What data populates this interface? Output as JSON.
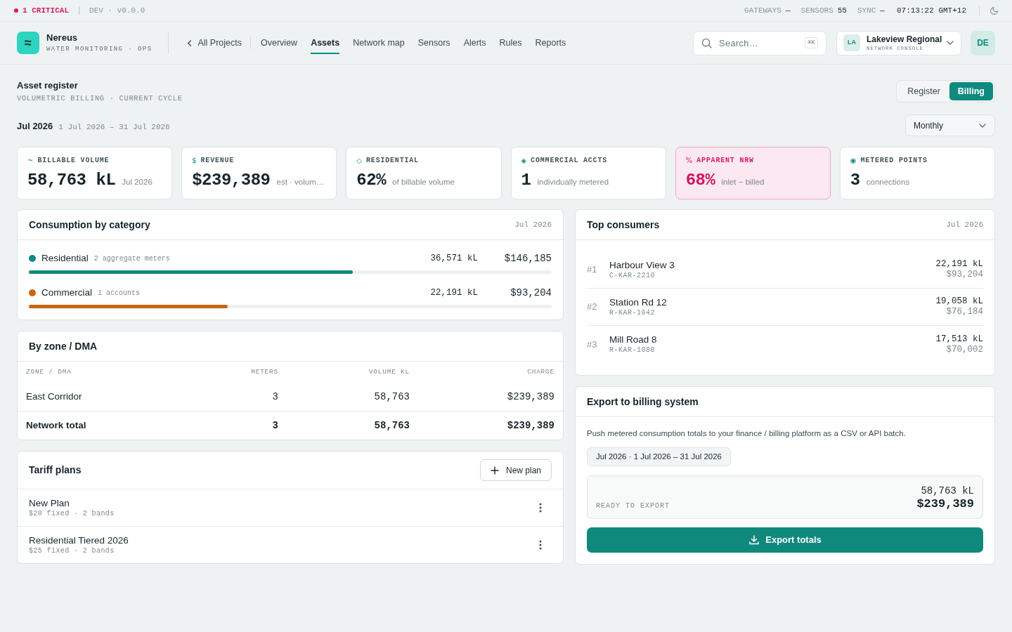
{
  "status_bar": {
    "critical": "1 CRITICAL",
    "environment": "DEV · v0.0.0",
    "stats": [
      {
        "label": "GATEWAYS",
        "value": "—"
      },
      {
        "label": "SENSORS",
        "value": "55"
      },
      {
        "label": "SYNC",
        "value": "—"
      }
    ],
    "clock": "07:13:22 GMT+12"
  },
  "header": {
    "logo": "≈",
    "app_name": "Nereus",
    "tagline": "WATER MONITORING · OPS",
    "back_link": "All Projects",
    "nav": [
      {
        "label": "Overview",
        "selected": false
      },
      {
        "label": "Assets",
        "selected": true
      },
      {
        "label": "Network map",
        "selected": false
      },
      {
        "label": "Sensors",
        "selected": false
      },
      {
        "label": "Alerts",
        "selected": false
      },
      {
        "label": "Rules",
        "selected": false
      },
      {
        "label": "Reports",
        "selected": false
      }
    ],
    "search": {
      "placeholder": "Search…",
      "shortcut": "⌘K"
    },
    "workspace": {
      "initials": "LA",
      "name": "Lakeview Regional",
      "subtitle": "NETWORK CONSOLE"
    },
    "user_initials": "DE"
  },
  "page": {
    "title": "Asset register",
    "subtitle": "VOLUMETRIC BILLING · CURRENT CYCLE",
    "period": "Jul 2026",
    "range": "1 Jul 2026 – 31 Jul 2026"
  },
  "view_toggle": [
    {
      "label": "Register",
      "selected": false
    },
    {
      "label": "Billing",
      "selected": true
    }
  ],
  "interval": "Monthly",
  "kpis": [
    {
      "marker": "~",
      "label": "BILLABLE VOLUME",
      "value": "58,763 kL",
      "note": "Jul 2026",
      "alert": false
    },
    {
      "marker": "$",
      "label": "REVENUE",
      "value": "$239,389",
      "note": "est · volum…",
      "alert": false
    },
    {
      "marker": "◇",
      "label": "RESIDENTIAL",
      "value": "62%",
      "note": "of billable volume",
      "alert": false
    },
    {
      "marker": "◈",
      "label": "COMMERCIAL ACCTS",
      "value": "1",
      "note": "individually metered",
      "alert": false
    },
    {
      "marker": "%",
      "label": "APPARENT NRW",
      "value": "68%",
      "note": "inlet − billed",
      "alert": true
    },
    {
      "marker": "◉",
      "label": "METERED POINTS",
      "value": "3",
      "note": "connections",
      "alert": false
    }
  ],
  "consumption": {
    "title": "Consumption by category",
    "period": "Jul 2026",
    "categories": [
      {
        "name": "Residential",
        "detail": "2 aggregate meters",
        "volume": "36,571 kL",
        "charge": "$146,185",
        "level": 0.62,
        "color": "#0f8a7e"
      },
      {
        "name": "Commercial",
        "detail": "1 accounts",
        "volume": "22,191 kL",
        "charge": "$93,204",
        "level": 0.38,
        "color": "#c8650f"
      }
    ]
  },
  "zones": {
    "title": "By zone / DMA",
    "columns": [
      "ZONE / DMA",
      "METERS",
      "VOLUME KL",
      "CHARGE"
    ],
    "rows": [
      {
        "cells": [
          "East Corridor",
          "3",
          "58,763",
          "$239,389"
        ],
        "total": false
      },
      {
        "cells": [
          "Network total",
          "3",
          "58,763",
          "$239,389"
        ],
        "total": true
      }
    ]
  },
  "tariffs": {
    "title": "Tariff plans",
    "new_button": "New plan",
    "plans": [
      {
        "name": "New Plan",
        "detail": "$20 fixed · 2 bands"
      },
      {
        "name": "Residential Tiered 2026",
        "detail": "$25 fixed · 2 bands"
      }
    ]
  },
  "top_consumers": {
    "title": "Top consumers",
    "period": "Jul 2026",
    "rows": [
      {
        "rank": "#1",
        "name": "Harbour View 3",
        "id": "C-KAR-2210",
        "volume": "22,191 kL",
        "charge": "$93,204"
      },
      {
        "rank": "#2",
        "name": "Station Rd 12",
        "id": "R-KAR-1042",
        "volume": "19,058 kL",
        "charge": "$76,184"
      },
      {
        "rank": "#3",
        "name": "Mill Road 8",
        "id": "R-KAR-1088",
        "volume": "17,513 kL",
        "charge": "$70,002"
      }
    ]
  },
  "export": {
    "title": "Export to billing system",
    "description": "Push metered consumption totals to your finance / billing platform as a CSV or API batch.",
    "period_chip": "Jul 2026 · 1 Jul 2026 – 31 Jul 2026",
    "summary_label": "READY TO EXPORT",
    "volume": "58,763 kL",
    "charge": "$239,389",
    "button": "Export totals"
  }
}
